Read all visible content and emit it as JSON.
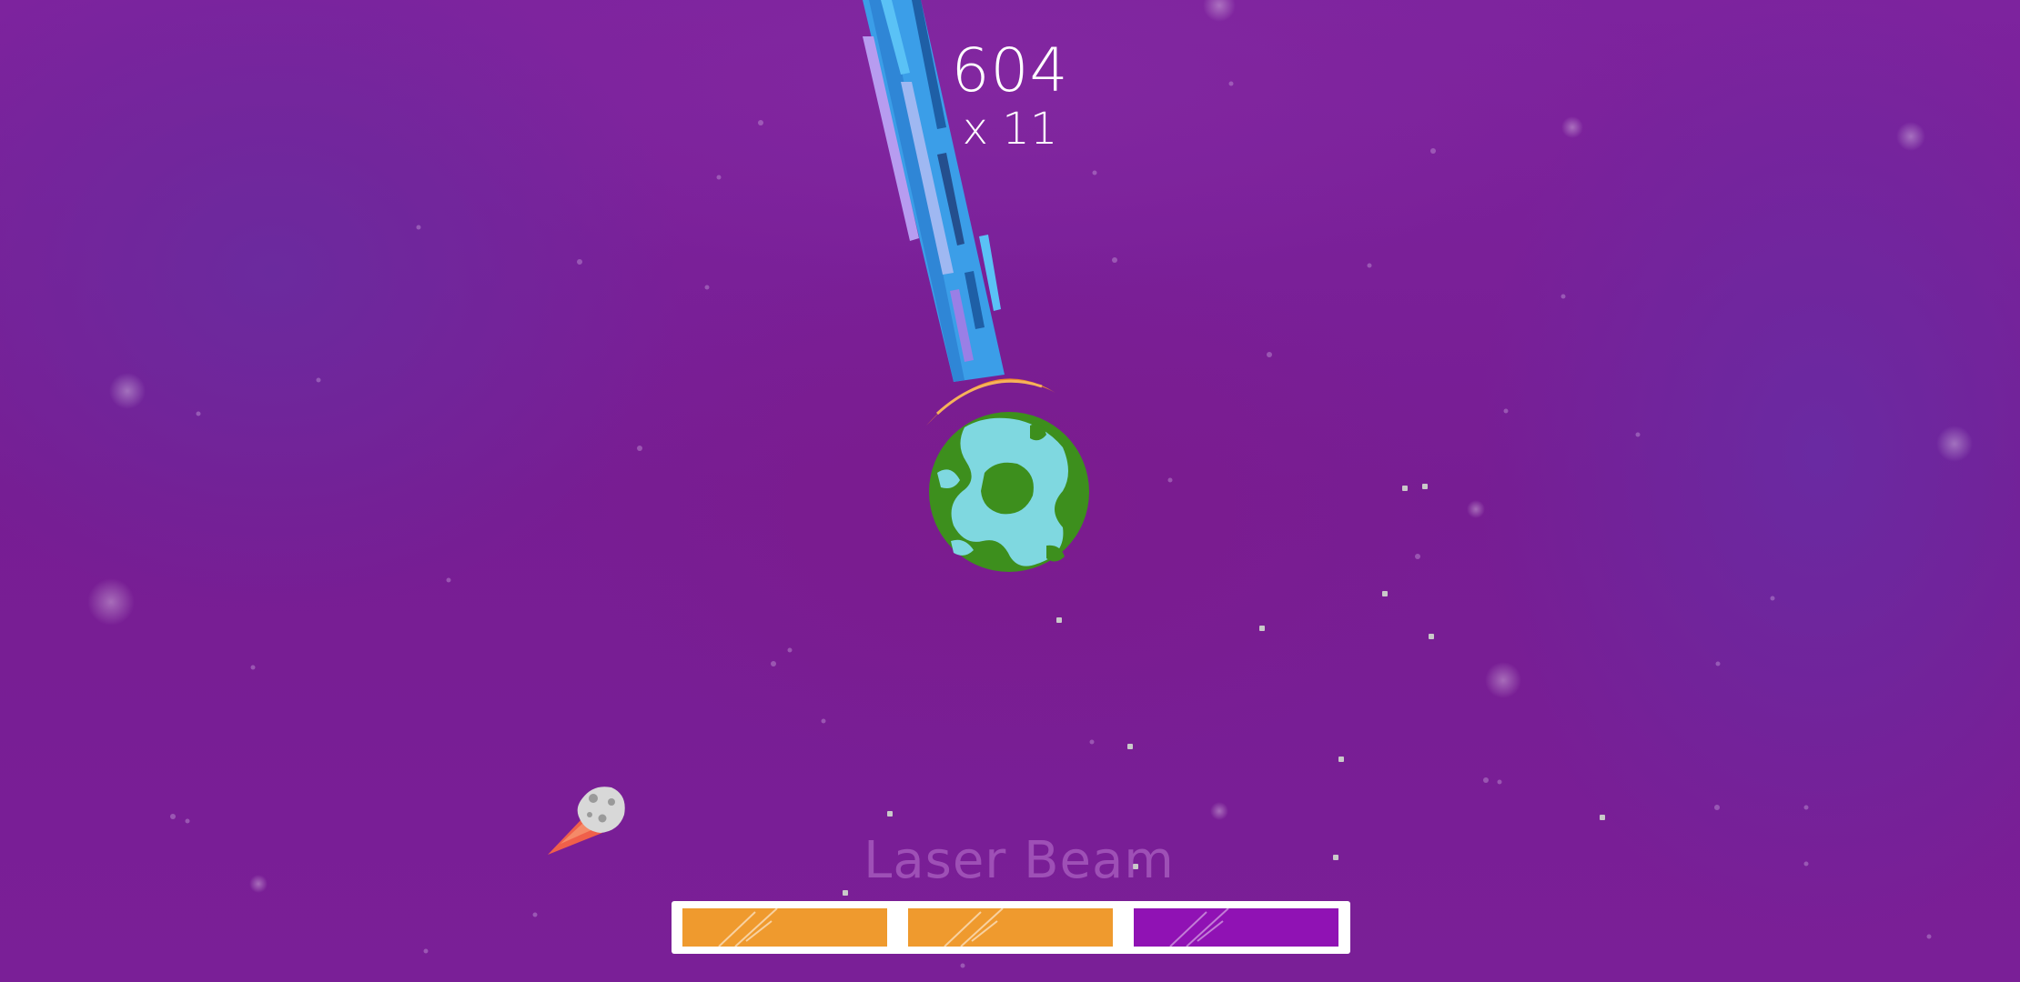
{
  "hud": {
    "score": "604",
    "multiplier": "x 11",
    "powerup_name": "Laser Beam"
  },
  "power_meter": {
    "segments": [
      {
        "state": "filled",
        "color": "#ef9a2e"
      },
      {
        "state": "filled",
        "color": "#ef9a2e"
      },
      {
        "state": "charging",
        "color": "#9012b4"
      }
    ]
  },
  "colors": {
    "background": "#7a1f9a",
    "laser_blue": "#3b9ee8",
    "planet_land": "#3d8f1d",
    "planet_water": "#7fd8e0",
    "shield": "#f08a2a",
    "asteroid_trail": "#f0604a"
  },
  "sprites": {
    "planet": "planet-earth-icon",
    "shield": "shield-arc-icon",
    "laser": "laser-beam-icon",
    "asteroid": "asteroid-icon"
  }
}
